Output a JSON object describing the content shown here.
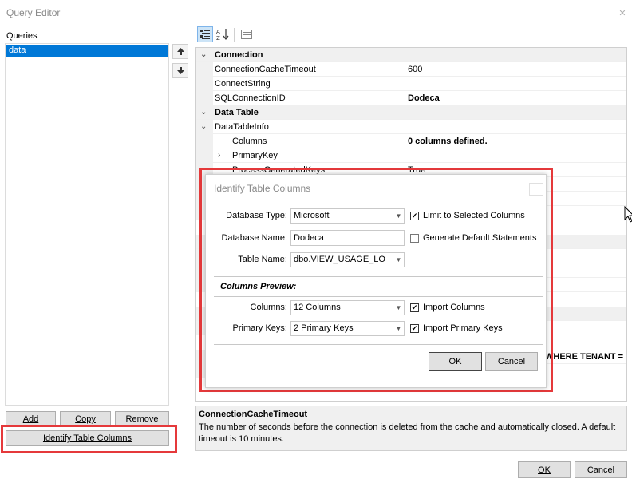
{
  "window": {
    "title": "Query Editor"
  },
  "queries": {
    "label": "Queries",
    "items": [
      "data"
    ]
  },
  "buttons": {
    "add": "Add",
    "copy": "Copy",
    "remove": "Remove",
    "identify": "Identify Table Columns",
    "ok": "OK",
    "cancel": "Cancel"
  },
  "grid": {
    "rows": [
      {
        "type": "cat",
        "chev": "⌄",
        "name": "Connection",
        "value": ""
      },
      {
        "type": "prop",
        "name": "ConnectionCacheTimeout",
        "value": "600",
        "bold": false
      },
      {
        "type": "prop",
        "name": "ConnectString",
        "value": "",
        "bold": false
      },
      {
        "type": "prop",
        "name": "SQLConnectionID",
        "value": "Dodeca",
        "bold": true
      },
      {
        "type": "cat",
        "chev": "⌄",
        "name": "Data Table",
        "value": ""
      },
      {
        "type": "prop",
        "chev": "⌄",
        "name": "DataTableInfo",
        "value": "",
        "bold": false
      },
      {
        "type": "prop",
        "indent": true,
        "name": "Columns",
        "value": "0 columns defined.",
        "bold": true
      },
      {
        "type": "prop",
        "indent": true,
        "chev": "›",
        "name": "PrimaryKey",
        "value": "",
        "bold": false
      },
      {
        "type": "prop",
        "indent": true,
        "name": "ProcessGeneratedKeys",
        "value": "True",
        "bold": false
      }
    ],
    "sql_fragment": "WHERE TENANT = '["
  },
  "description": {
    "title": "ConnectionCacheTimeout",
    "body": "The number of seconds before the connection is deleted from the cache and automatically closed.  A default timeout is 10 minutes."
  },
  "dialog": {
    "title": "Identify Table Columns",
    "database_type_label": "Database Type:",
    "database_type_value": "Microsoft",
    "database_name_label": "Database Name:",
    "database_name_value": "Dodeca",
    "table_name_label": "Table Name:",
    "table_name_value": "dbo.VIEW_USAGE_LO",
    "limit_label": "Limit to Selected Columns",
    "limit_checked": true,
    "generate_label": "Generate Default Statements",
    "generate_checked": false,
    "preview_label": "Columns Preview:",
    "columns_label": "Columns:",
    "columns_value": "12 Columns",
    "import_columns_label": "Import Columns",
    "import_columns_checked": true,
    "primary_keys_label": "Primary Keys:",
    "primary_keys_value": "2 Primary Keys",
    "import_pk_label": "Import Primary Keys",
    "import_pk_checked": true,
    "ok": "OK",
    "cancel": "Cancel"
  },
  "colors": {
    "selection": "#0078d7",
    "highlight": "#e5393b"
  }
}
